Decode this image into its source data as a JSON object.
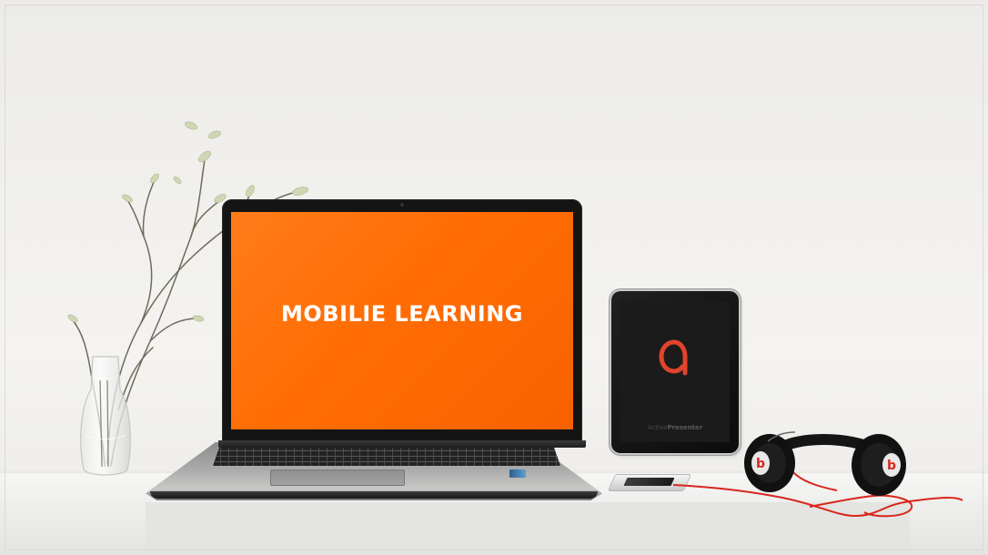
{
  "laptop": {
    "screen_text": "MOBILIE LEARNING",
    "screen_color": "#ff6d04"
  },
  "tablet": {
    "brand_prefix": "Active",
    "brand_suffix": "Presenter",
    "logo_icon": "activepresenter-logo-icon",
    "logo_color": "#e0442c"
  },
  "headphones": {
    "icon": "headphones-icon",
    "accent_color": "#d7261e"
  },
  "plant": {
    "icon": "plant-branch-icon"
  }
}
